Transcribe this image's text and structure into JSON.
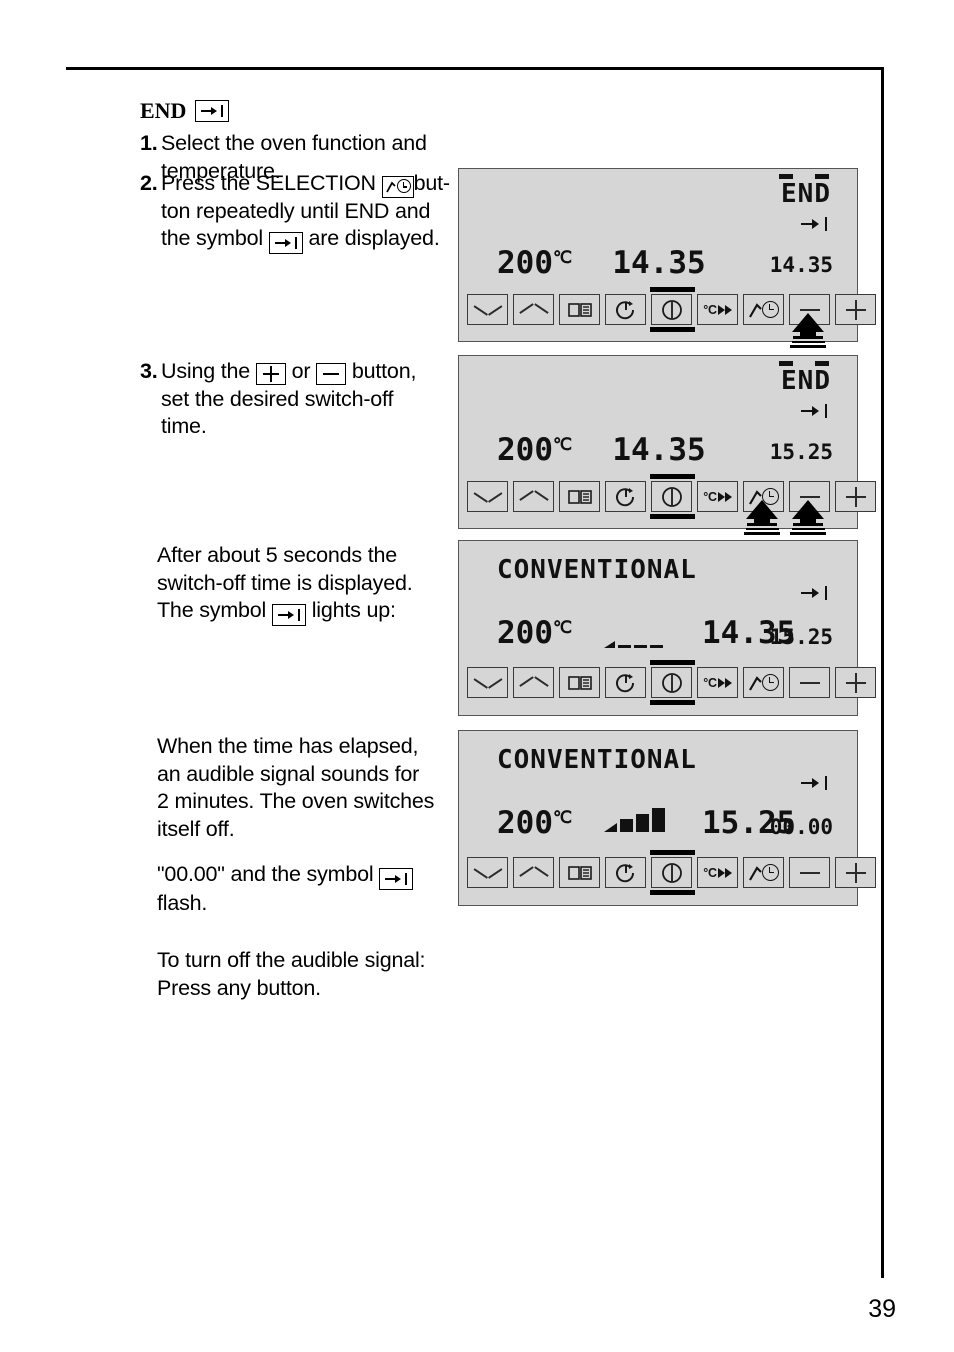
{
  "page": {
    "number": "39",
    "heading": {
      "label": "END",
      "symbol_name": "end-arrow-symbol"
    }
  },
  "steps": [
    {
      "num": "1.",
      "text_before": "Select the oven function and temperature.",
      "text_after": "",
      "text_tail": ""
    },
    {
      "num": "2.",
      "text_before": "Press the SELECTION",
      "text_mid": "but-",
      "text_line2": "ton repeatedly until END and",
      "text_line3_before": "the symbol",
      "text_line3_after": "are displayed."
    },
    {
      "num": "3.",
      "text_before": "Using the",
      "text_or": "or",
      "text_after": "button,",
      "text_line2": "set the desired switch-off",
      "text_line3": "time."
    }
  ],
  "notes": [
    {
      "line1": "After about 5 seconds the",
      "line2": "switch-off time is displayed.",
      "line3_before": "The symbol",
      "line3_after": "lights up:"
    },
    {
      "line1": "When the time has elapsed,",
      "line2": "an audible signal sounds for",
      "line3": "2 minutes. The oven switches",
      "line4": "itself off."
    },
    {
      "line1_before": "\"00.00\" and the symbol",
      "line1_after": "",
      "line2": "flash."
    },
    {
      "line1": "To turn off the audible signal:",
      "line2": "Press any button."
    }
  ],
  "button_labels": {
    "down": "down-arrow",
    "up": "up-arrow",
    "book": "book",
    "timer": "timer",
    "power": "power",
    "temp": "°C",
    "selection": "selection",
    "minus": "minus",
    "plus": "plus"
  },
  "panels": [
    {
      "id": "panel-1",
      "mode_text": "END",
      "mode_align": "right",
      "flashing": true,
      "temperature": "200",
      "unit": "℃",
      "clock": "14.35",
      "secondary": "14.35",
      "bargraph": "none",
      "end_symbol_visible": true,
      "pressed_button": "selection"
    },
    {
      "id": "panel-2",
      "mode_text": "END",
      "mode_align": "right",
      "flashing": true,
      "temperature": "200",
      "unit": "℃",
      "clock": "14.35",
      "secondary": "15.25",
      "bargraph": "none",
      "end_symbol_visible": true,
      "pressed_button": "minus-plus"
    },
    {
      "id": "panel-3",
      "mode_text": "CONVENTIONAL",
      "mode_align": "left",
      "flashing": false,
      "temperature": "200",
      "unit": "℃",
      "clock": "14.35",
      "secondary": "15.25",
      "bargraph": "low",
      "end_symbol_visible": true,
      "pressed_button": "none"
    },
    {
      "id": "panel-4",
      "mode_text": "CONVENTIONAL",
      "mode_align": "left",
      "flashing": false,
      "temperature": "200",
      "unit": "℃",
      "clock": "15.25",
      "secondary": "00.00",
      "bargraph": "full",
      "end_symbol_visible": true,
      "pressed_button": "none"
    }
  ],
  "colors": {
    "panel_background": "#d6d6d6",
    "panel_border": "#555555",
    "lcd_text": "#111111",
    "page_text": "#000000"
  }
}
